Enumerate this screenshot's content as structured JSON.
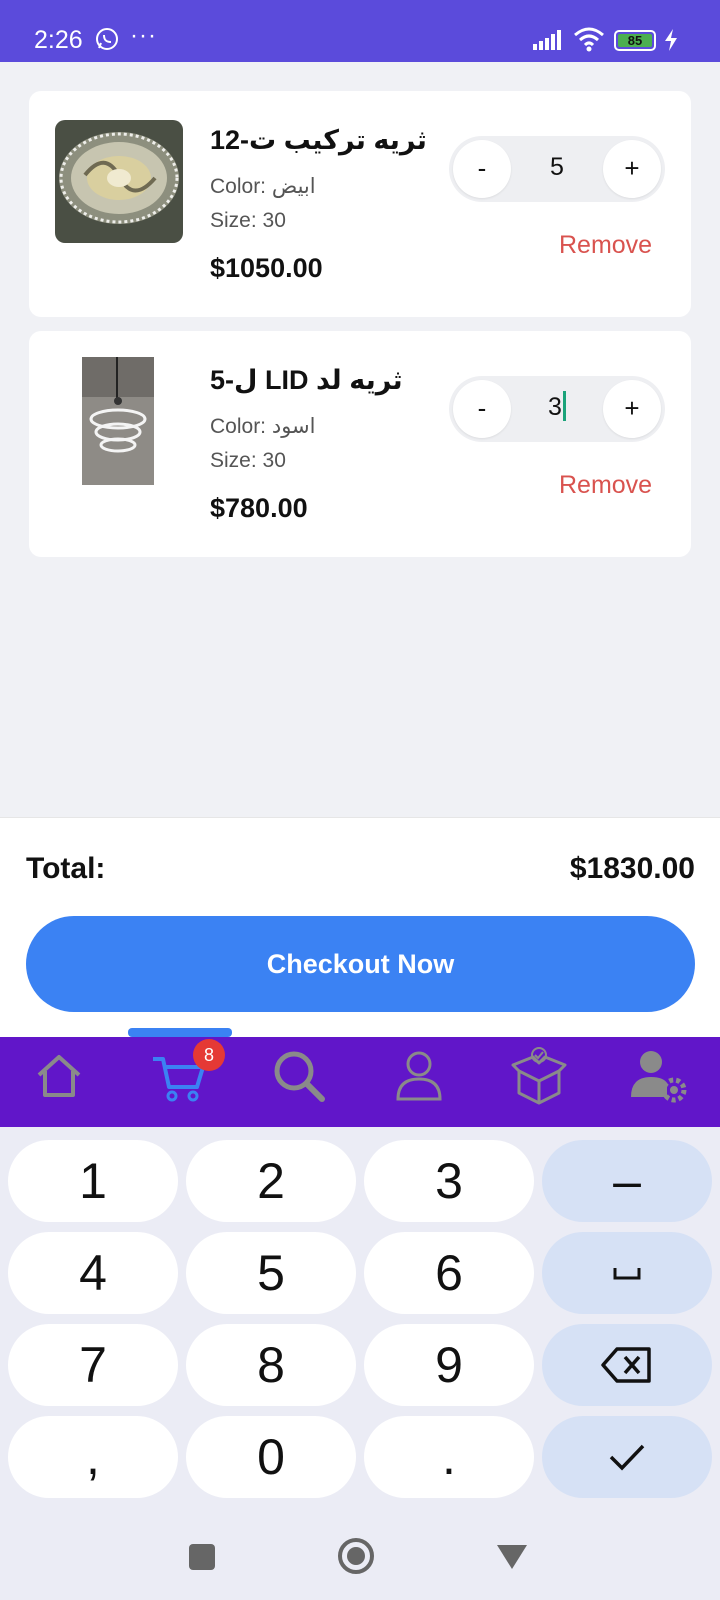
{
  "status_bar": {
    "time": "2:26",
    "more": "···",
    "battery": "85"
  },
  "cart": {
    "items": [
      {
        "name": "ثريه تركيب ت-12",
        "color": "Color: ابيض",
        "size": "Size: 30",
        "price": "$1050.00",
        "quantity": "5",
        "minus": "-",
        "plus": "+",
        "remove": "Remove"
      },
      {
        "name": "ثريه لد LID ل-5",
        "color": "Color: اسود",
        "size": "Size: 30",
        "price": "$780.00",
        "quantity": "3",
        "minus": "-",
        "plus": "+",
        "remove": "Remove"
      }
    ]
  },
  "summary": {
    "total_label": "Total:",
    "total_value": "$1830.00",
    "checkout_label": "Checkout Now"
  },
  "nav": {
    "cart_badge": "8",
    "active": "cart",
    "colors": {
      "bar": "#6116c9",
      "active": "#3b82f3",
      "inactive": "#8a8a8a"
    }
  },
  "keyboard": {
    "keys": [
      "1",
      "2",
      "3",
      "–",
      "4",
      "5",
      "6",
      "space",
      "7",
      "8",
      "9",
      "backspace",
      ",",
      "0",
      ".",
      "done"
    ]
  },
  "theme": {
    "status_bar": "#5b4bdb",
    "primary": "#3b82f3",
    "danger": "#d9534f"
  }
}
